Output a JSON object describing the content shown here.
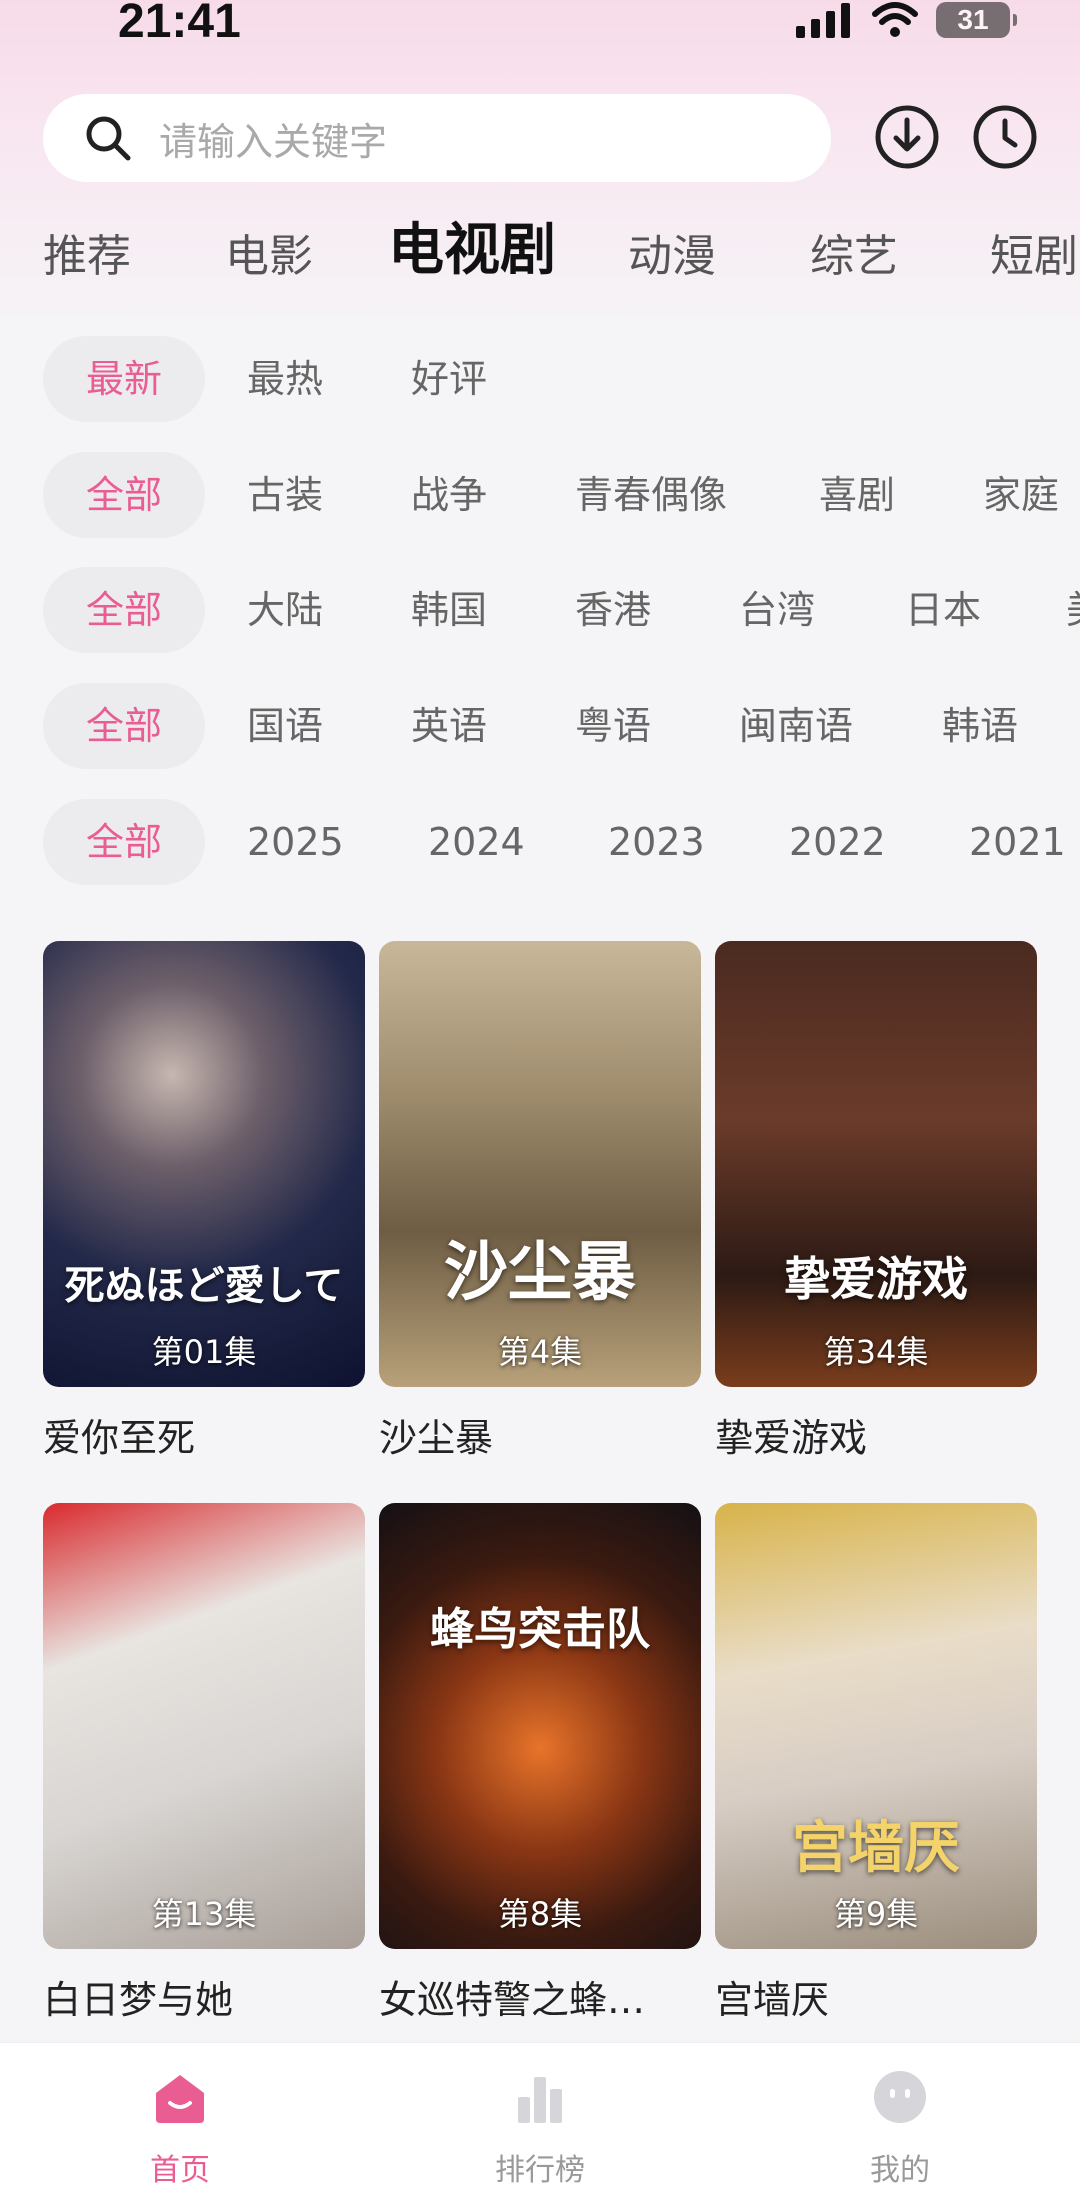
{
  "status_bar": {
    "time": "21:41",
    "battery": "31"
  },
  "search": {
    "placeholder": "请输入关键字"
  },
  "category_tabs": [
    {
      "label": "推荐",
      "active": false
    },
    {
      "label": "电影",
      "active": false
    },
    {
      "label": "电视剧",
      "active": true
    },
    {
      "label": "动漫",
      "active": false
    },
    {
      "label": "综艺",
      "active": false
    },
    {
      "label": "短剧",
      "active": false
    }
  ],
  "filters": {
    "sort": {
      "selected": "最新",
      "options": [
        "最热",
        "好评"
      ]
    },
    "genre": {
      "selected": "全部",
      "options": [
        "古装",
        "战争",
        "青春偶像",
        "喜剧",
        "家庭"
      ]
    },
    "region": {
      "selected": "全部",
      "options": [
        "大陆",
        "韩国",
        "香港",
        "台湾",
        "日本",
        "美"
      ]
    },
    "language": {
      "selected": "全部",
      "options": [
        "国语",
        "英语",
        "粤语",
        "闽南语",
        "韩语"
      ]
    },
    "year": {
      "selected": "全部",
      "options": [
        "2025",
        "2024",
        "2023",
        "2022",
        "2021"
      ]
    }
  },
  "shows": [
    {
      "name": "爱你至死",
      "episode": "第01集",
      "poster_text": "死ぬほど愛して"
    },
    {
      "name": "沙尘暴",
      "episode": "第4集",
      "poster_text": "沙尘暴"
    },
    {
      "name": "挚爱游戏",
      "episode": "第34集",
      "poster_text": "挚爱游戏"
    },
    {
      "name": "白日梦与她",
      "episode": "第13集",
      "poster_text": ""
    },
    {
      "name": "女巡特警之蜂…",
      "episode": "第8集",
      "poster_text": "蜂鸟突击队"
    },
    {
      "name": "宫墙厌",
      "episode": "第9集",
      "poster_text": "宫墙厌"
    }
  ],
  "bottom_nav": [
    {
      "label": "首页",
      "icon": "home-icon",
      "active": true
    },
    {
      "label": "排行榜",
      "icon": "ranking-icon",
      "active": false
    },
    {
      "label": "我的",
      "icon": "profile-icon",
      "active": false
    }
  ],
  "colors": {
    "accent": "#ea5d93",
    "chip_bg": "#ececef"
  }
}
